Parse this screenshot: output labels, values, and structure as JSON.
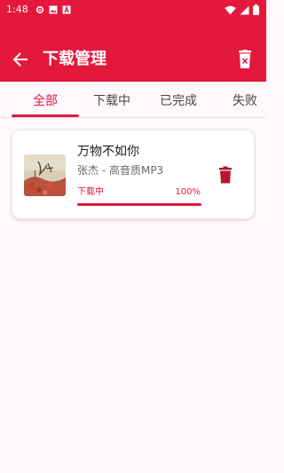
{
  "status_bar": {
    "time": "1:48",
    "icons": [
      "settings-icon",
      "image-icon",
      "font-icon",
      "wifi-icon",
      "signal-icon",
      "battery-icon"
    ]
  },
  "app_bar": {
    "title": "下载管理",
    "back_icon": "arrow-left-icon",
    "action_icon": "trash-clear-icon"
  },
  "tabs": [
    {
      "label": "全部",
      "active": true
    },
    {
      "label": "下载中",
      "active": false
    },
    {
      "label": "已完成",
      "active": false
    },
    {
      "label": "失败",
      "active": false
    }
  ],
  "downloads": [
    {
      "title": "万物不如你",
      "meta": "张杰 - 高音质MP3",
      "status": "下载中",
      "progress_text": "100%",
      "progress": 1.0,
      "cover_icon": "album-cover",
      "delete_icon": "trash-icon"
    }
  ],
  "colors": {
    "accent": "#e3183c",
    "background": "#fdf8fb",
    "card": "#ffffff",
    "delete_icon": "#b81531"
  }
}
